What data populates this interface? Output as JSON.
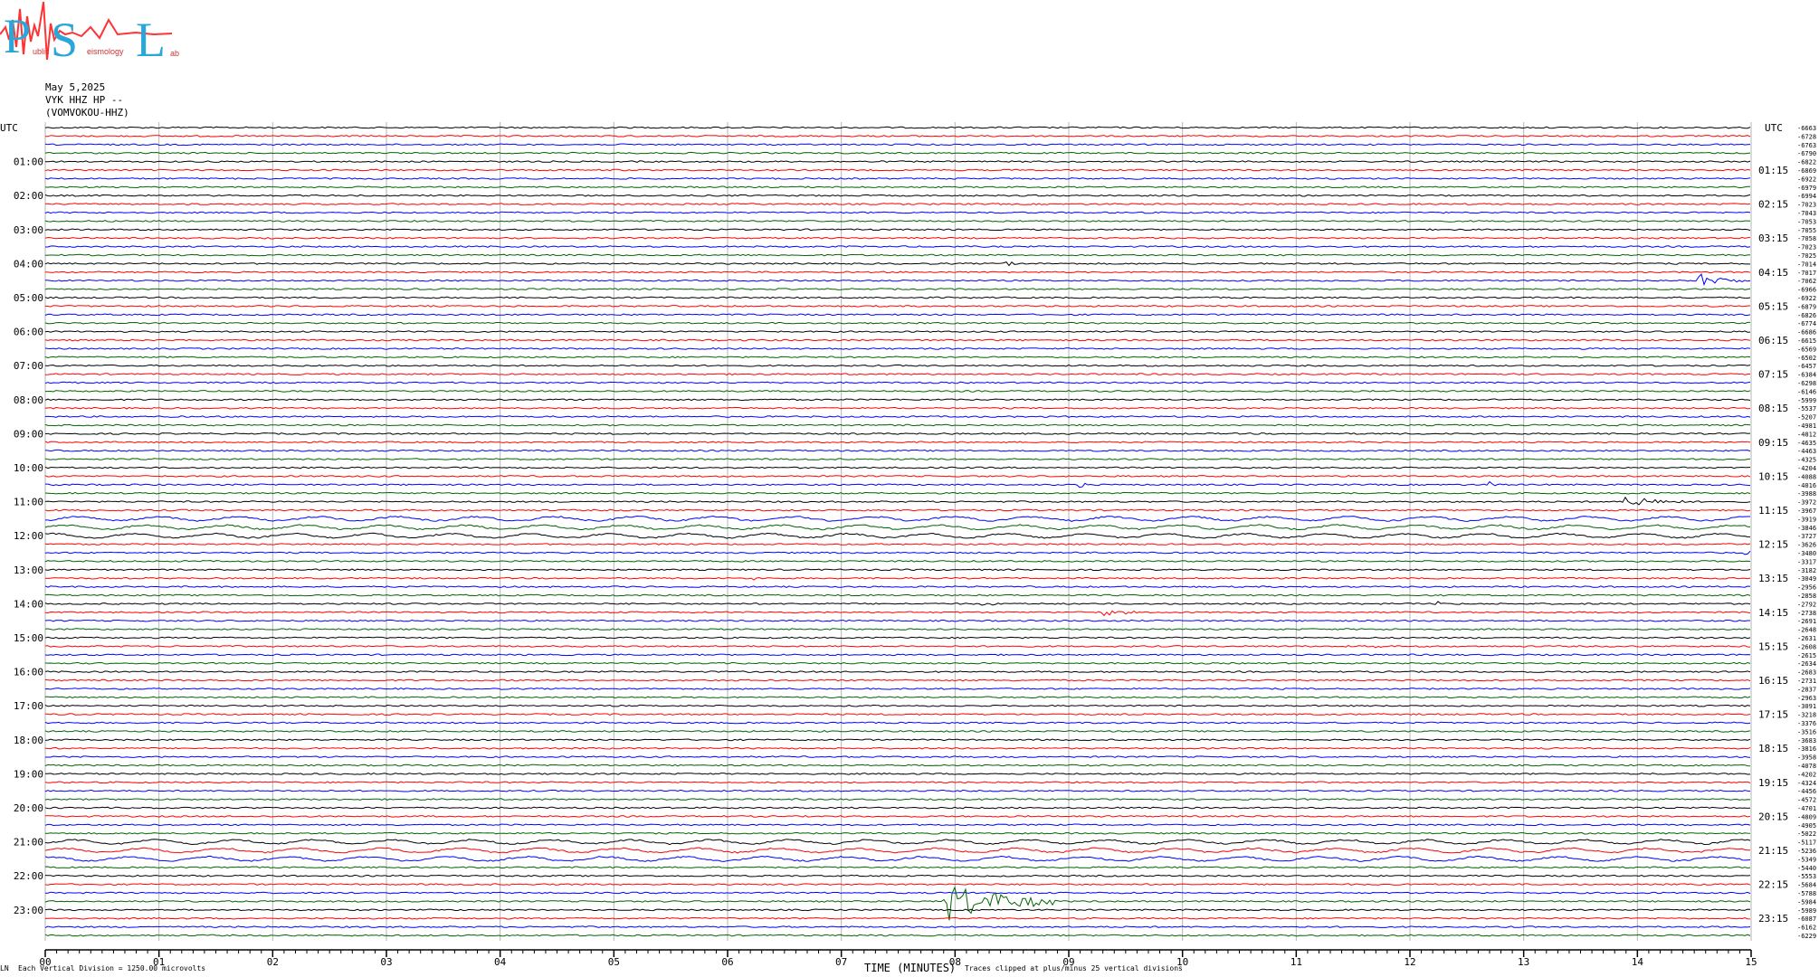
{
  "logo": {
    "text_p": "P",
    "text_s": "S",
    "text_l": "L",
    "sub1": "ublic",
    "sub2": "eismology",
    "sub3": "ab"
  },
  "header": {
    "date": "May 5,2025",
    "station": "VYK HHZ HP --",
    "name": "(VOMVOKOU-HHZ)"
  },
  "left_axis_label": "UTC",
  "right_axis_label": "UTC",
  "footer": {
    "vertical_division": "Each Vertical Division = 1250.00 microvolts",
    "clip_note": "Traces clipped at plus/minus 25 vertical divisions",
    "tiny_mark": "LN"
  },
  "chart_data": {
    "type": "line",
    "title": "",
    "xlabel": "TIME (MINUTES)",
    "xlim": [
      0,
      15
    ],
    "x_ticks": [
      "00",
      "01",
      "02",
      "03",
      "04",
      "05",
      "06",
      "07",
      "08",
      "09",
      "10",
      "11",
      "12",
      "13",
      "14",
      "15"
    ],
    "row_minutes": 15,
    "rows_per_hour": 4,
    "trace_color_cycle": [
      "#000000",
      "#ff0000",
      "#0000ff",
      "#006400"
    ],
    "left_hour_labels": [
      "01:00",
      "02:00",
      "03:00",
      "04:00",
      "05:00",
      "06:00",
      "07:00",
      "08:00",
      "09:00",
      "10:00",
      "11:00",
      "12:00",
      "13:00",
      "14:00",
      "15:00",
      "16:00",
      "17:00",
      "18:00",
      "19:00",
      "20:00",
      "21:00",
      "22:00",
      "23:00"
    ],
    "right_hour_labels": [
      "01:15",
      "02:15",
      "03:15",
      "04:15",
      "05:15",
      "06:15",
      "07:15",
      "08:15",
      "09:15",
      "10:15",
      "11:15",
      "12:15",
      "13:15",
      "14:15",
      "15:15",
      "16:15",
      "17:15",
      "18:15",
      "19:15",
      "20:15",
      "21:15",
      "22:15",
      "23:15"
    ],
    "row_offsets": [
      "-6663",
      "-6728",
      "-6763",
      "-6790",
      "-6822",
      "-6869",
      "-6922",
      "-6979",
      "-6994",
      "-7023",
      "-7043",
      "-7053",
      "-7055",
      "-7058",
      "-7023",
      "-7025",
      "-7014",
      "-7017",
      "-7062",
      "-6966",
      "-6922",
      "-6879",
      "-6826",
      "-6774",
      "-6686",
      "-6615",
      "-6569",
      "-6502",
      "-6457",
      "-6384",
      "-6298",
      "-6146",
      "-5999",
      "-5537",
      "-5207",
      "-4981",
      "-4812",
      "-4635",
      "-4463",
      "-4325",
      "-4204",
      "-4088",
      "-4016",
      "-3988",
      "-3972",
      "-3967",
      "-3919",
      "-3846",
      "-3727",
      "-3626",
      "-3480",
      "-3317",
      "-3182",
      "-3049",
      "-2956",
      "-2858",
      "-2792",
      "-2738",
      "-2691",
      "-2648",
      "-2631",
      "-2608",
      "-2615",
      "-2634",
      "-2683",
      "-2731",
      "-2837",
      "-2963",
      "-3091",
      "-3218",
      "-3376",
      "-3516",
      "-3683",
      "-3816",
      "-3958",
      "-4078",
      "-4202",
      "-4324",
      "-4456",
      "-4572",
      "-4701",
      "-4809",
      "-4905",
      "-5022",
      "-5117",
      "-5236",
      "-5349",
      "-5440",
      "-5553",
      "-5684",
      "-5788",
      "-5984",
      "-5989",
      "-6087",
      "-6162",
      "-6229"
    ],
    "events": [
      {
        "row": 16,
        "minute": 8.45,
        "amp": 0.35,
        "dur": 0.3
      },
      {
        "row": 18,
        "minute": 14.55,
        "amp": 0.9,
        "dur": 0.4
      },
      {
        "row": 42,
        "minute": 9.1,
        "amp": 0.45,
        "dur": 0.1
      },
      {
        "row": 42,
        "minute": 12.7,
        "amp": 0.35,
        "dur": 0.1
      },
      {
        "row": 44,
        "minute": 13.9,
        "amp": 0.6,
        "dur": 0.6
      },
      {
        "row": 50,
        "minute": 14.9,
        "amp": 0.3,
        "dur": 0.2
      },
      {
        "row": 53,
        "minute": 6.25,
        "amp": 0.2,
        "dur": 0.05
      },
      {
        "row": 57,
        "minute": 9.3,
        "amp": 0.45,
        "dur": 0.3
      },
      {
        "row": 56,
        "minute": 8.25,
        "amp": 0.2,
        "dur": 0.15
      },
      {
        "row": 56,
        "minute": 12.25,
        "amp": 0.3,
        "dur": 0.15
      },
      {
        "row": 61,
        "minute": 11.7,
        "amp": 0.45,
        "dur": 0.05
      },
      {
        "row": 91,
        "minute": 7.9,
        "amp": 2.6,
        "dur": 1.0
      }
    ]
  }
}
